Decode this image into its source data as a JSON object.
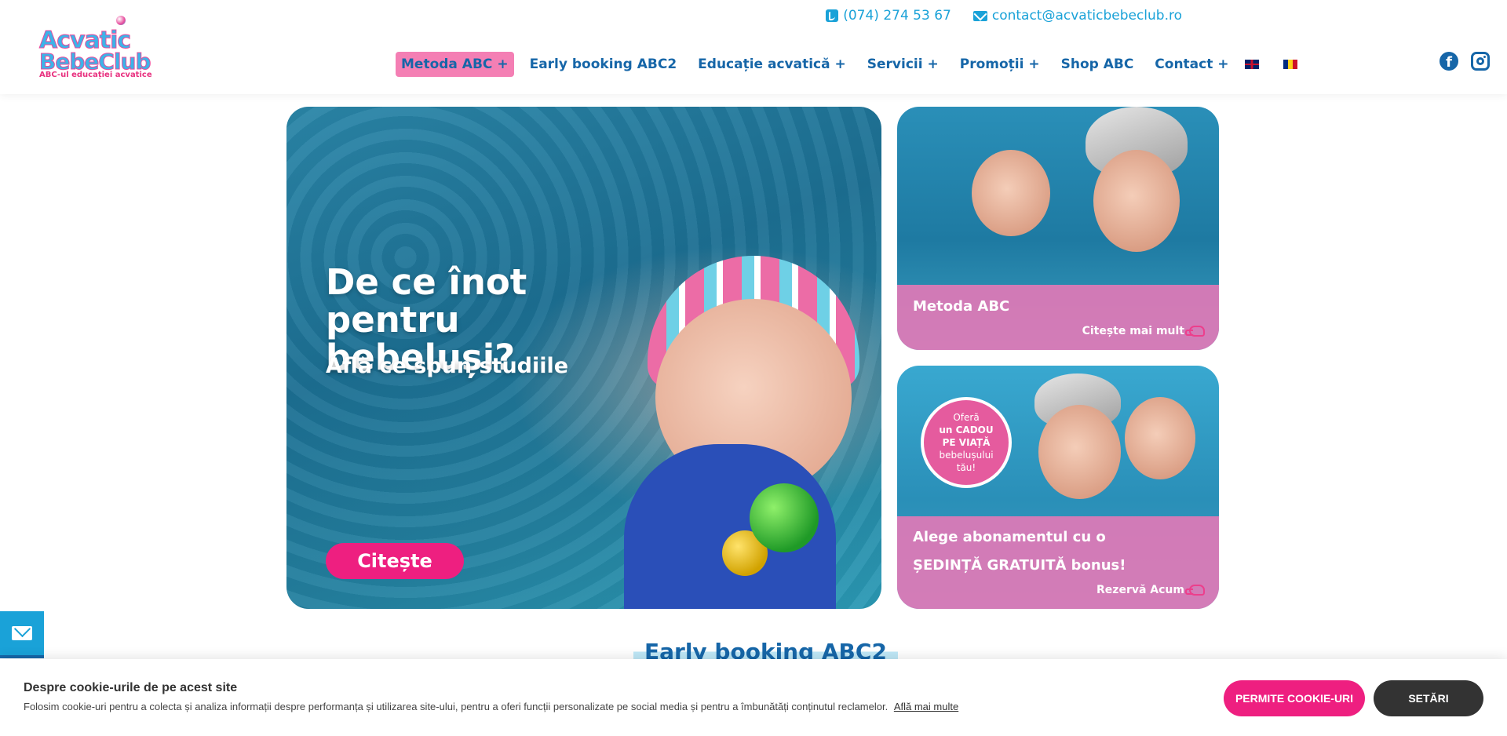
{
  "header": {
    "logo_line1": "Acvatic",
    "logo_line2": "BebeClub",
    "logo_tagline": "ABC-ul educației acvatice",
    "phone": "(074) 274 53 67",
    "email": "contact@acvaticbebeclub.ro",
    "nav": [
      {
        "label": "Metoda ABC +",
        "active": true
      },
      {
        "label": "Early booking ABC2"
      },
      {
        "label": "Educație acvatică +"
      },
      {
        "label": "Servicii +"
      },
      {
        "label": "Promoții +"
      },
      {
        "label": "Shop ABC"
      },
      {
        "label": "Contact +"
      }
    ],
    "flags": [
      "flag-uk-icon",
      "flag-ro-icon"
    ],
    "social": [
      "facebook-icon",
      "instagram-icon"
    ]
  },
  "hero": {
    "title": "De ce înot pentru bebeluși?",
    "subtitle": "Află ce spun studiile",
    "cta": "Citește"
  },
  "cards": [
    {
      "title": "Metoda ABC",
      "more": "Citește mai mult"
    },
    {
      "badge": {
        "l1": "Oferă",
        "l2": "un CADOU",
        "l3": "PE VIAȚĂ",
        "l4": "bebelușului",
        "l5": "tău!"
      },
      "title_line1": "Alege abonamentul cu o",
      "title_line2": "ȘEDINȚĂ GRATUITĂ bonus!",
      "more": "Rezervă Acum"
    }
  ],
  "section": {
    "title": "Early booking ABC2"
  },
  "cookie": {
    "title": "Despre cookie-urile de pe acest site",
    "text": "Folosim cookie-uri pentru a colecta și analiza informații despre performanța și utilizarea site-ului, pentru a oferi funcții personalizate pe social media și pentru a îmbunătăți conținutul reclamelor.",
    "link": "Află mai multe",
    "allow_label": "PERMITE COOKIE-URI",
    "settings_label": "SETĂRI"
  },
  "colors": {
    "accent_pink": "#ee1f80",
    "nav_blue": "#1666a8",
    "link_blue": "#1aa2d8",
    "card_pink": "#e878b6"
  }
}
